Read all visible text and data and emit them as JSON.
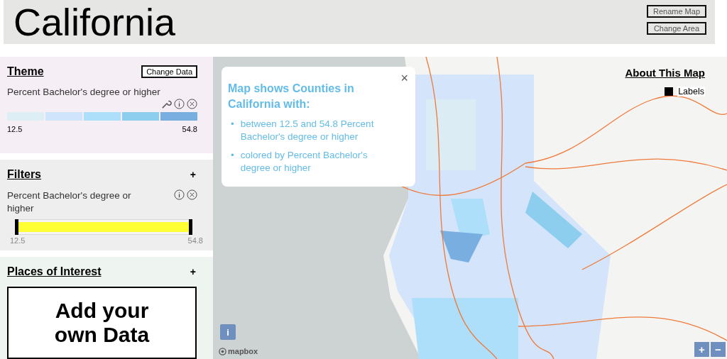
{
  "header": {
    "title": "California",
    "buttons": [
      "Rename Map",
      "Change Area"
    ]
  },
  "sidebar": {
    "theme": {
      "heading": "Theme",
      "button": "Change Data",
      "variable": "Percent Bachelor's degree or higher",
      "legend": [
        {
          "color": "#ddeef5"
        },
        {
          "color": "#d0e5fb"
        },
        {
          "color": "#addffa"
        },
        {
          "color": "#8dcdee"
        },
        {
          "color": "#78afe0"
        }
      ],
      "min": "12.5",
      "max": "54.8"
    },
    "filters": {
      "heading": "Filters",
      "add": "+",
      "items": [
        {
          "label": "Percent Bachelor's degree or higher",
          "level": 1,
          "min": "12.5",
          "max": "54.8"
        }
      ]
    },
    "places": {
      "heading": "Places of Interest",
      "add": "+",
      "button": "Add your own Data"
    }
  },
  "map": {
    "popup": {
      "title": "Map shows Counties in California with:",
      "close": "×",
      "bullets": [
        {
          "marker": "•",
          "text": "between 12.5 and 54.8 Percent Bachelor's degree or higher"
        },
        {
          "marker": "•",
          "text": "colored by Percent Bachelor's degree or higher"
        }
      ]
    },
    "about_link": "About This Map",
    "labels_toggle": {
      "label": "Labels",
      "checked": true
    },
    "info_button": "i",
    "attribution": "mapbox",
    "zoom_buttons": [
      "+",
      "−"
    ]
  }
}
